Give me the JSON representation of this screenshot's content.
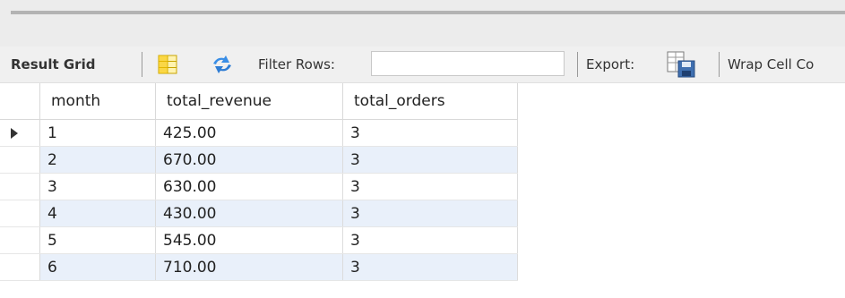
{
  "toolbar": {
    "result_grid_label": "Result Grid",
    "filter_rows_label": "Filter Rows:",
    "filter_rows_value": "",
    "export_label": "Export:",
    "wrap_cell_label": "Wrap Cell Co"
  },
  "icons": {
    "grid": "grid-icon",
    "refresh": "refresh-icon",
    "export": "export-icon",
    "row_pointer": "row-pointer-icon"
  },
  "colors": {
    "alt_row": "#e9f0fa",
    "toolbar_bg": "#f0f0f0"
  },
  "table": {
    "columns": [
      "month",
      "total_revenue",
      "total_orders"
    ],
    "rows": [
      [
        "1",
        "425.00",
        "3"
      ],
      [
        "2",
        "670.00",
        "3"
      ],
      [
        "3",
        "630.00",
        "3"
      ],
      [
        "4",
        "430.00",
        "3"
      ],
      [
        "5",
        "545.00",
        "3"
      ],
      [
        "6",
        "710.00",
        "3"
      ]
    ],
    "selected_row": 0
  }
}
